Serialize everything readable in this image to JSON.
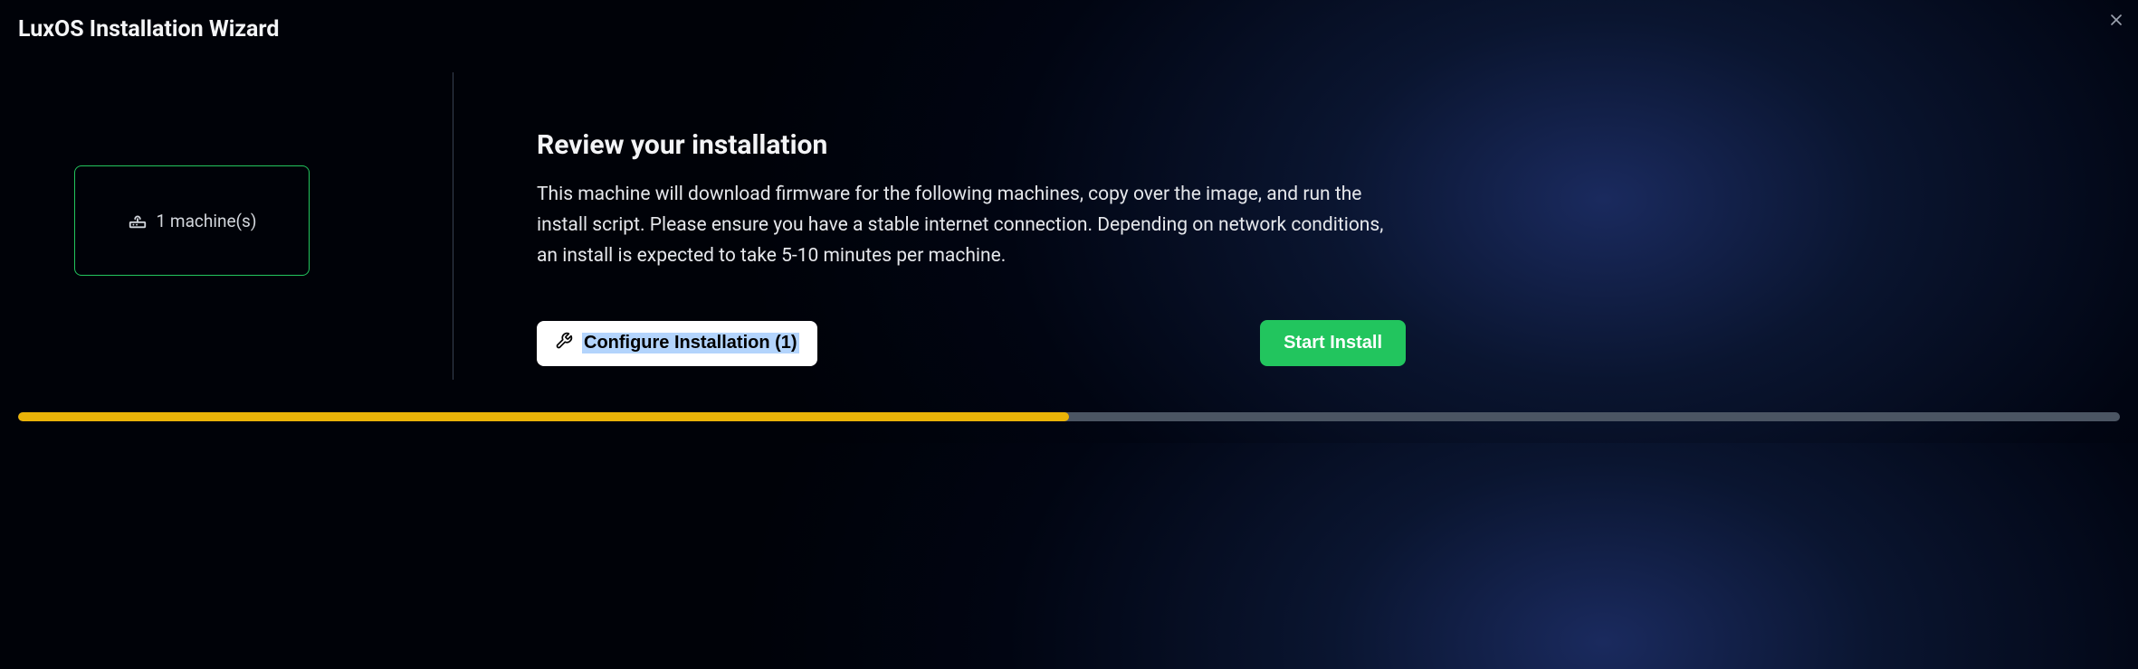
{
  "header": {
    "title": "LuxOS Installation Wizard"
  },
  "sidebar": {
    "machine_count_text": "1 machine(s)"
  },
  "main": {
    "heading": "Review your installation",
    "description": "This machine will download firmware for the following machines, copy over the image, and run the install script. Please ensure you have a stable internet connection. Depending on network conditions, an install is expected to take 5-10 minutes per machine.",
    "configure_label": "Configure Installation (1)",
    "start_label": "Start Install"
  },
  "progress": {
    "percent": 50
  }
}
